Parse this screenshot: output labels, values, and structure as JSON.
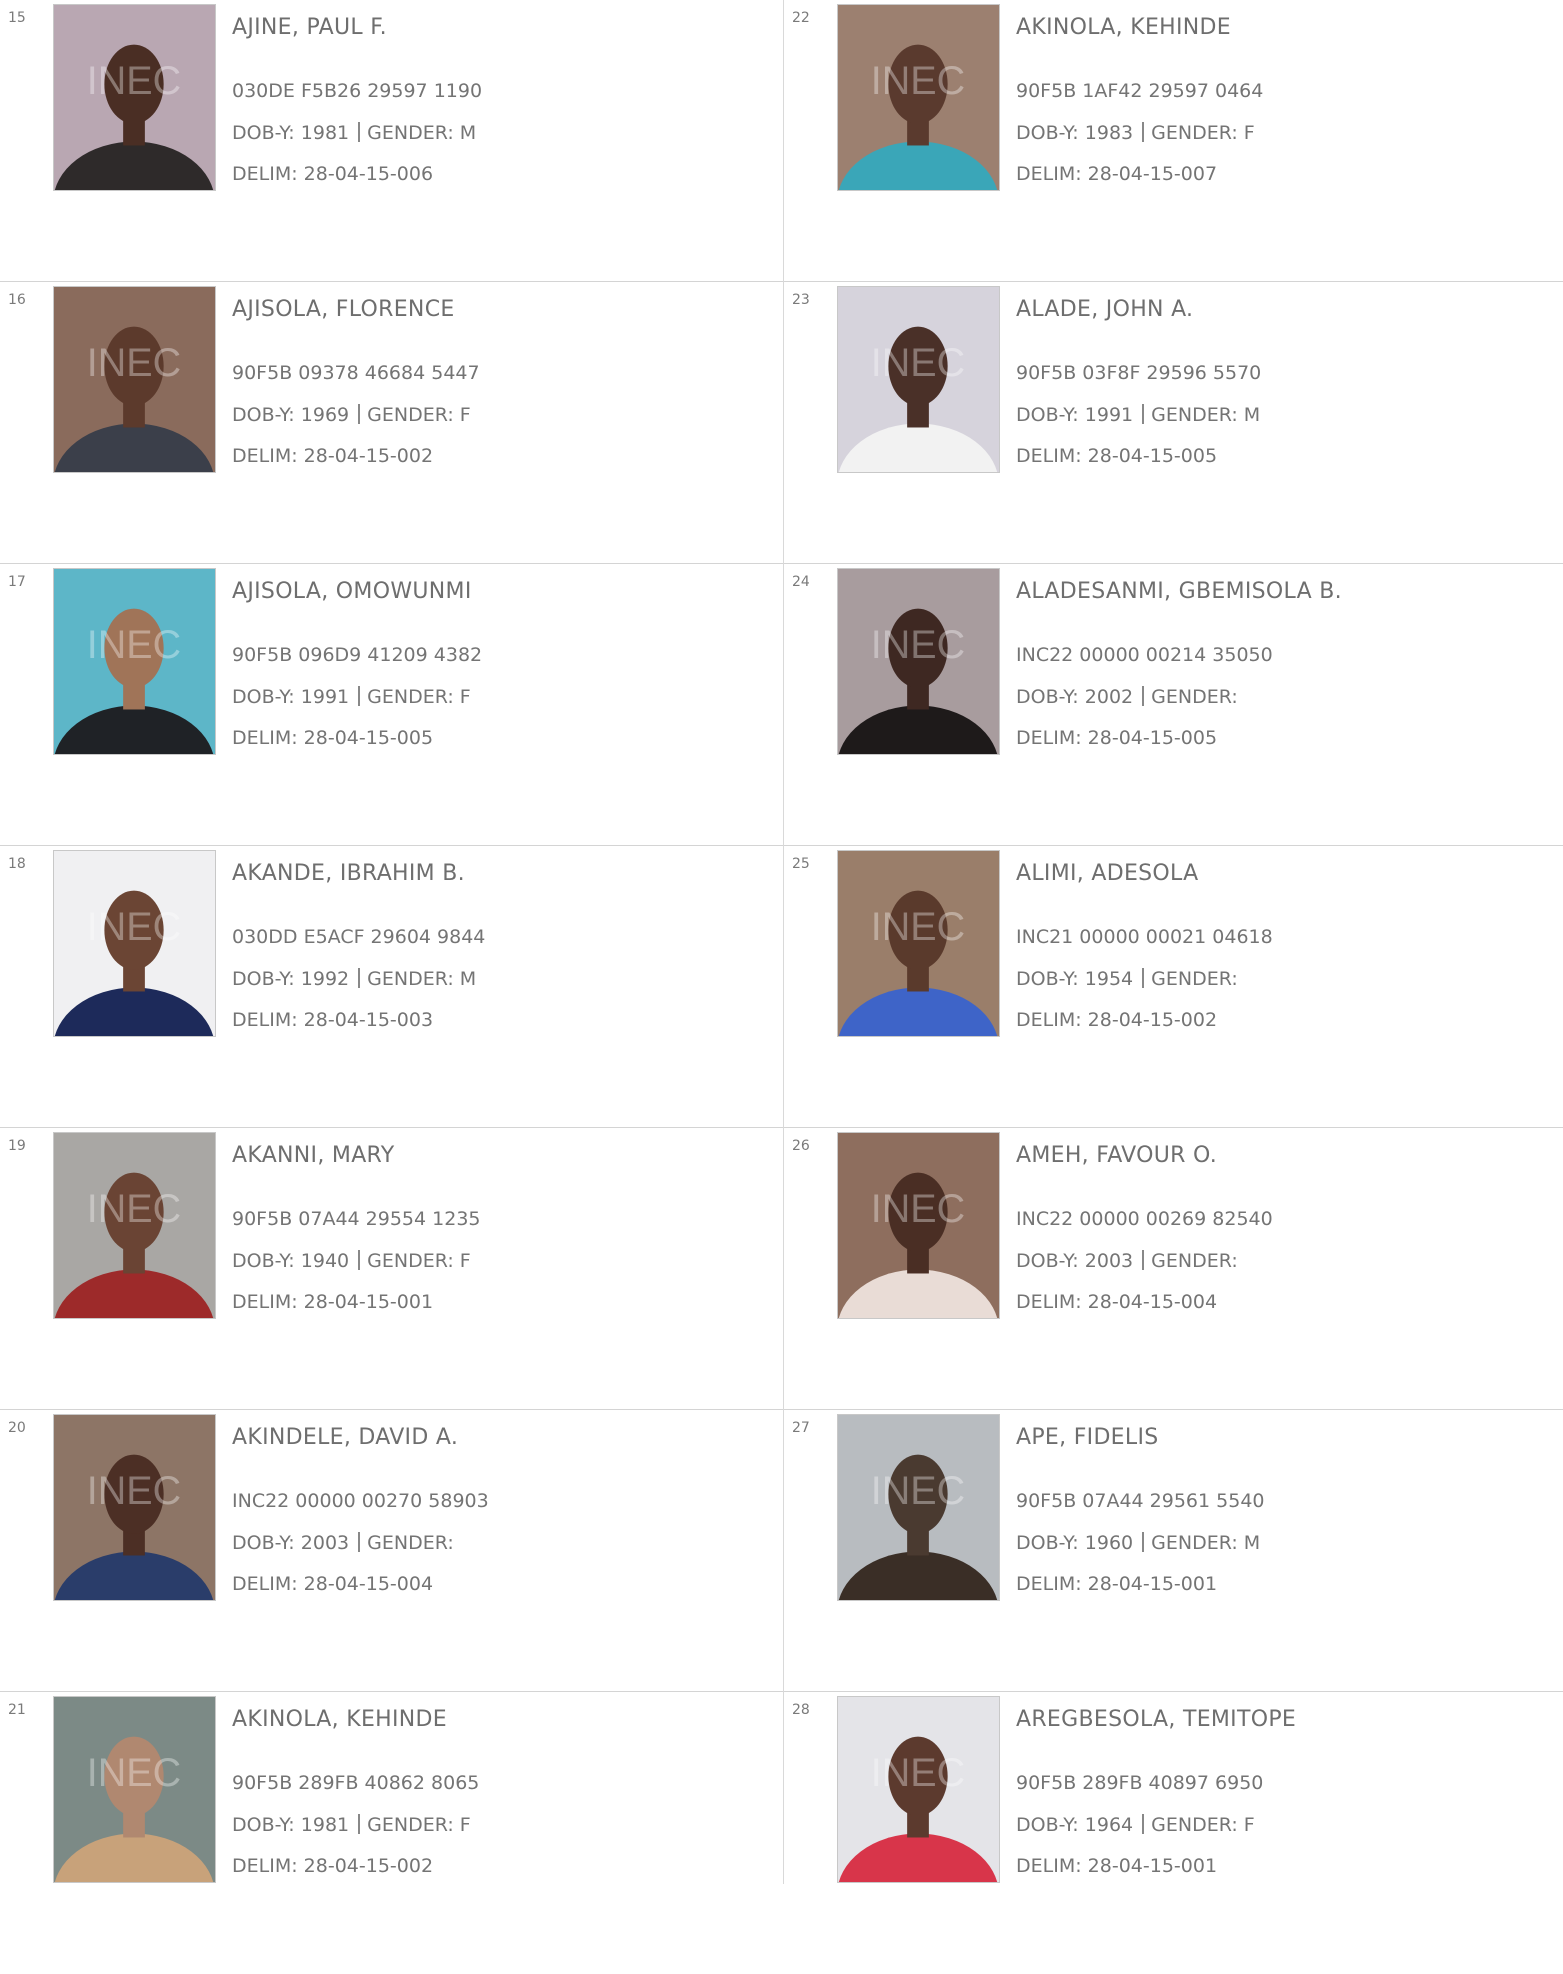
{
  "labels": {
    "dob": "DOB-Y:",
    "gender": "GENDER:",
    "delim": "DELIM:"
  },
  "watermark": "INEC",
  "left_column": [
    {
      "num": "15",
      "name": "AJINE, PAUL F.",
      "vin": "030DE F5B26 29597 1190",
      "dob": "1981",
      "gender": "M",
      "delim": "28-04-15-006",
      "photo": {
        "bg": "#b9a7b2",
        "skin": "#4a2e24",
        "top": "#2e2a2a"
      }
    },
    {
      "num": "16",
      "name": "AJISOLA, FLORENCE",
      "vin": "90F5B 09378 46684 5447",
      "dob": "1969",
      "gender": "F",
      "delim": "28-04-15-002",
      "photo": {
        "bg": "#8a6b5c",
        "skin": "#5c3a2c",
        "top": "#3b3f4a"
      }
    },
    {
      "num": "17",
      "name": "AJISOLA, OMOWUNMI",
      "vin": "90F5B 096D9 41209 4382",
      "dob": "1991",
      "gender": "F",
      "delim": "28-04-15-005",
      "photo": {
        "bg": "#5db6c8",
        "skin": "#a07458",
        "top": "#1f2226"
      }
    },
    {
      "num": "18",
      "name": "AKANDE, IBRAHIM B.",
      "vin": "030DD E5ACF 29604 9844",
      "dob": "1992",
      "gender": "M",
      "delim": "28-04-15-003",
      "photo": {
        "bg": "#f0f0f2",
        "skin": "#6b4534",
        "top": "#1d2a5a"
      }
    },
    {
      "num": "19",
      "name": "AKANNI, MARY",
      "vin": "90F5B 07A44 29554 1235",
      "dob": "1940",
      "gender": "F",
      "delim": "28-04-15-001",
      "photo": {
        "bg": "#a9a7a4",
        "skin": "#6a4434",
        "top": "#9d2a2a"
      }
    },
    {
      "num": "20",
      "name": "AKINDELE, DAVID A.",
      "vin": "INC22 00000 00270 58903",
      "dob": "2003",
      "gender": "",
      "delim": "28-04-15-004",
      "photo": {
        "bg": "#8d7566",
        "skin": "#4c2f25",
        "top": "#2a3d6a"
      }
    },
    {
      "num": "21",
      "name": "AKINOLA, KEHINDE",
      "vin": "90F5B 289FB 40862 8065",
      "dob": "1981",
      "gender": "F",
      "delim": "28-04-15-002",
      "photo": {
        "bg": "#7c8a86",
        "skin": "#b08870",
        "top": "#c8a27a"
      }
    }
  ],
  "right_column": [
    {
      "num": "22",
      "name": "AKINOLA, KEHINDE",
      "vin": "90F5B 1AF42 29597 0464",
      "dob": "1983",
      "gender": "F",
      "delim": "28-04-15-007",
      "photo": {
        "bg": "#9c8070",
        "skin": "#5a3a2e",
        "top": "#3aa6b8"
      }
    },
    {
      "num": "23",
      "name": "ALADE, JOHN A.",
      "vin": "90F5B 03F8F 29596 5570",
      "dob": "1991",
      "gender": "M",
      "delim": "28-04-15-005",
      "photo": {
        "bg": "#d6d3dc",
        "skin": "#4a3028",
        "top": "#f2f2f2"
      }
    },
    {
      "num": "24",
      "name": "ALADESANMI, GBEMISOLA B.",
      "vin": "INC22 00000 00214 35050",
      "dob": "2002",
      "gender": "",
      "delim": "28-04-15-005",
      "photo": {
        "bg": "#a89c9e",
        "skin": "#3e2822",
        "top": "#1e1a1a"
      }
    },
    {
      "num": "25",
      "name": "ALIMI, ADESOLA",
      "vin": "INC21 00000 00021 04618",
      "dob": "1954",
      "gender": "",
      "delim": "28-04-15-002",
      "photo": {
        "bg": "#9a7e6a",
        "skin": "#5a3a2c",
        "top": "#3e64c8"
      }
    },
    {
      "num": "26",
      "name": "AMEH, FAVOUR O.",
      "vin": "INC22 00000 00269 82540",
      "dob": "2003",
      "gender": "",
      "delim": "28-04-15-004",
      "photo": {
        "bg": "#8e6e5e",
        "skin": "#4a2e24",
        "top": "#e9dcd6"
      }
    },
    {
      "num": "27",
      "name": "APE, FIDELIS",
      "vin": "90F5B 07A44 29561 5540",
      "dob": "1960",
      "gender": "M",
      "delim": "28-04-15-001",
      "photo": {
        "bg": "#b8bcc0",
        "skin": "#4a3a30",
        "top": "#3a2e26"
      }
    },
    {
      "num": "28",
      "name": "AREGBESOLA, TEMITOPE",
      "vin": "90F5B 289FB 40897 6950",
      "dob": "1964",
      "gender": "F",
      "delim": "28-04-15-001",
      "photo": {
        "bg": "#e4e4e8",
        "skin": "#5c3a2e",
        "top": "#d8354a"
      }
    }
  ]
}
